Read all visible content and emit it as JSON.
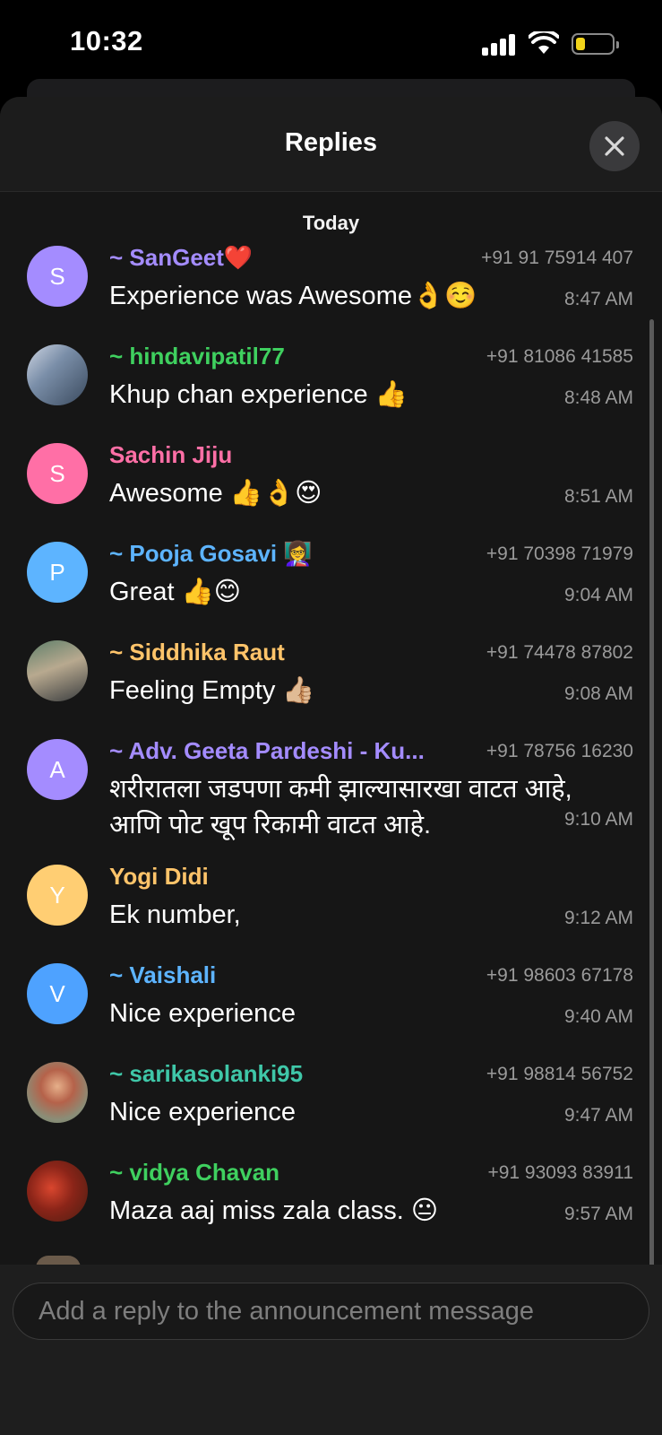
{
  "status_bar": {
    "time": "10:32"
  },
  "sheet": {
    "title": "Replies",
    "date_label": "Today"
  },
  "colors": {
    "sangeet": "#a48cff",
    "hindavi": "#3fd05f",
    "sachin": "#ff6fa6",
    "pooja": "#5db4ff",
    "siddhika": "#ffc46a",
    "geeta": "#a48cff",
    "yogi": "#ffc46a",
    "vaishali": "#5db4ff",
    "sarika": "#3fc7a8",
    "vidya": "#3fd05f"
  },
  "replies": [
    {
      "sender": "~ SanGeet❤️",
      "phone": "+91 91 75914 407",
      "text": "Experience was Awesome👌☺️",
      "time": "8:47 AM",
      "initial": "S"
    },
    {
      "sender": "~ hindavipatil77",
      "phone": "+91 81086 41585",
      "text": "Khup chan experience 👍",
      "time": "8:48 AM"
    },
    {
      "sender": "Sachin Jiju",
      "phone": "",
      "text": "Awesome 👍👌😍",
      "time": "8:51 AM",
      "initial": "S"
    },
    {
      "sender": "~ Pooja Gosavi 👩‍🏫",
      "phone": "+91 70398 71979",
      "text": "Great 👍😊",
      "time": "9:04 AM",
      "initial": "P"
    },
    {
      "sender": "~ Siddhika Raut",
      "phone": "+91 74478 87802",
      "text": "Feeling Empty 👍🏼",
      "time": "9:08 AM"
    },
    {
      "sender": "~ Adv. Geeta Pardeshi - Ku...",
      "phone": "+91 78756 16230",
      "text_line1": "शरीरातला जडपणा कमी झाल्यासारखा वाटत आहे,",
      "text_line2": "आणि पोट खूप रिकामी वाटत आहे.",
      "time": "9:10 AM",
      "initial": "A"
    },
    {
      "sender": "Yogi Didi",
      "phone": "",
      "text": "Ek number,",
      "time": "9:12 AM",
      "initial": "Y"
    },
    {
      "sender": "~ Vaishali",
      "phone": "+91 98603 67178",
      "text": "Nice experience",
      "time": "9:40 AM",
      "initial": "V"
    },
    {
      "sender": "~ sarikasolanki95",
      "phone": "+91 98814 56752",
      "text": "Nice experience",
      "time": "9:47 AM"
    },
    {
      "sender": "~ vidya Chavan",
      "phone": "+91 93093 83911",
      "text": "Maza aaj miss zala class. 😐",
      "time": "9:57 AM"
    }
  ],
  "footer": {
    "input_placeholder": "Add a reply to the announcement message"
  }
}
